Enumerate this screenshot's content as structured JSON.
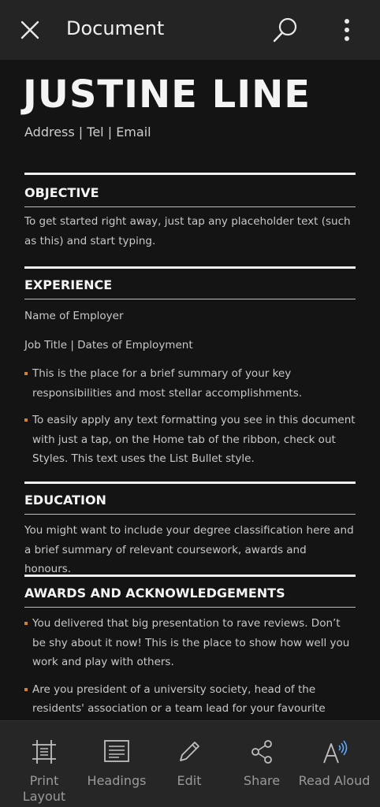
{
  "topbar": {
    "title": "Document"
  },
  "resume": {
    "name": "JUSTINE LINE",
    "contact": "Address | Tel | Email",
    "objective": {
      "title": "OBJECTIVE",
      "text": "To get started right away, just tap any placeholder text (such as this) and start typing."
    },
    "experience": {
      "title": "EXPERIENCE",
      "employer": "Name of Employer",
      "job": "Job Title | Dates of Employment",
      "bullets": [
        "This is the place for a brief summary of your key responsibilities and most stellar accomplishments.",
        "To easily apply any text formatting you see in this document with just a tap, on the Home tab of the ribbon, check out Styles. This text uses the List Bullet style."
      ]
    },
    "education": {
      "title": "EDUCATION",
      "text": "You might want to include your degree classification here and a brief summary of relevant coursework, awards and honours."
    },
    "awards": {
      "title": "AWARDS AND ACKNOWLEDGEMENTS",
      "bullets": [
        "You delivered that big presentation to rave reviews. Don’t be shy about it now! This is the place to show how well you work and play with others.",
        "Are you president of a university society, head of the residents' association or a team lead for your favourite charity? You’re a"
      ]
    }
  },
  "bottombar": {
    "print_layout": "Print Layout",
    "headings": "Headings",
    "edit": "Edit",
    "share": "Share",
    "read_aloud": "Read Aloud"
  },
  "colors": {
    "bullet_accent": "#d4822f",
    "read_aloud_accent": "#5aa8ff"
  }
}
